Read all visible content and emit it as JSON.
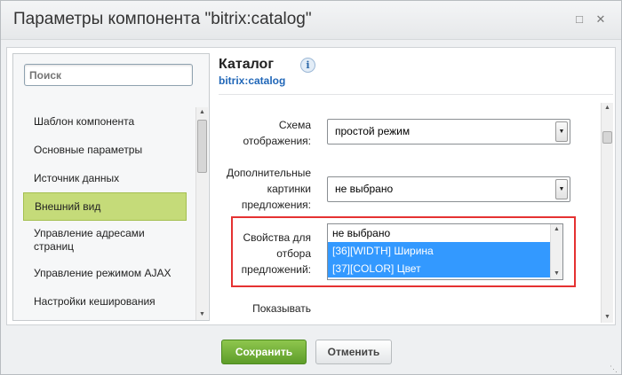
{
  "window": {
    "title": "Параметры компонента \"bitrix:catalog\"",
    "maximize_icon": "maximize-icon",
    "close_icon": "close-icon"
  },
  "sidebar": {
    "search_placeholder": "Поиск",
    "items": [
      {
        "label": "Шаблон компонента",
        "active": false
      },
      {
        "label": "Основные параметры",
        "active": false
      },
      {
        "label": "Источник данных",
        "active": false
      },
      {
        "label": "Внешний вид",
        "active": true
      },
      {
        "label": "Управление адресами страниц",
        "active": false
      },
      {
        "label": "Управление режимом AJAX",
        "active": false
      },
      {
        "label": "Настройки кеширования",
        "active": false
      }
    ]
  },
  "main": {
    "heading": "Каталог",
    "subheading": "bitrix:catalog",
    "info_icon": "info-icon",
    "fields": [
      {
        "label": "Схема отображения:",
        "value": "простой режим"
      },
      {
        "label": "Дополнительные картинки предложения:",
        "value": "не выбрано"
      },
      {
        "label": "Свойства для отбора предложений:",
        "options": [
          {
            "text": "не выбрано",
            "selected": false
          },
          {
            "text": "[36][WIDTH] Ширина",
            "selected": true
          },
          {
            "text": "[37][COLOR] Цвет",
            "selected": true
          }
        ]
      },
      {
        "label": "Показывать"
      }
    ]
  },
  "footer": {
    "save_label": "Сохранить",
    "cancel_label": "Отменить"
  },
  "colors": {
    "active_nav": "#c5db79",
    "selected_option": "#3399ff",
    "highlight_border": "#e53232",
    "save_button": "#6aa834",
    "link": "#2167b8"
  }
}
